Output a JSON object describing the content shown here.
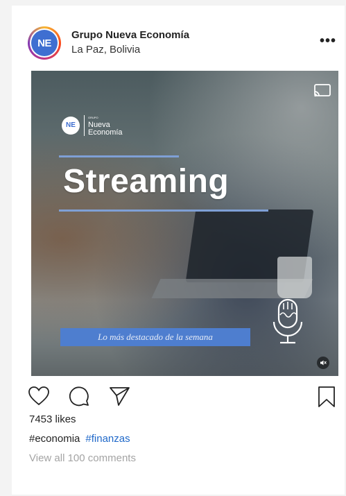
{
  "post": {
    "account_name": "Grupo Nueva Economía",
    "location": "La Paz, Bolivia",
    "avatar_text": "NE",
    "more_label": "•••",
    "likes_text": "7453 likes",
    "tags": [
      "#economia",
      "#finanzas"
    ],
    "comments_link": "View all 100 comments"
  },
  "media": {
    "brand_logo_text": "NE",
    "brand_grupo": "GRUPO",
    "brand_nueva": "Nueva",
    "brand_economia": "Economía",
    "title": "Streaming",
    "banner": "Lo más destacado de la semana"
  },
  "icons": {
    "cast": "cast-icon",
    "mic": "microphone-icon",
    "mute": "mute-icon",
    "like": "heart-icon",
    "comment": "comment-icon",
    "share": "send-icon",
    "save": "bookmark-icon"
  },
  "colors": {
    "brand_blue": "#3f6fd1",
    "hashtag_link": "#1f68c9",
    "banner_blue": "#4e7ecf",
    "muted_text": "#a4a4a4"
  }
}
